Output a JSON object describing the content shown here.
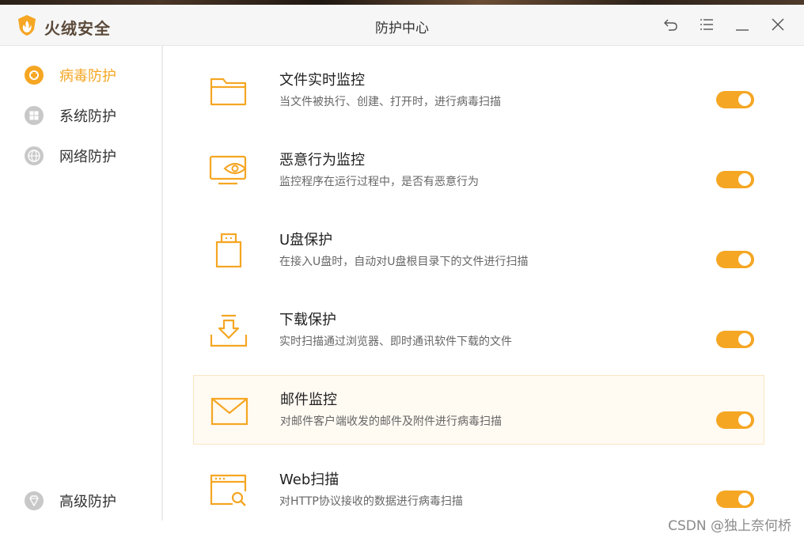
{
  "app": {
    "brand": "火绒安全",
    "window_title": "防护中心"
  },
  "titlebar_icons": [
    "undo-icon",
    "menu-icon",
    "minimize-icon",
    "close-icon"
  ],
  "sidebar": {
    "items": [
      {
        "label": "病毒防护",
        "icon": "virus-shield-icon",
        "active": true
      },
      {
        "label": "系统防护",
        "icon": "windows-icon",
        "active": false
      },
      {
        "label": "网络防护",
        "icon": "globe-icon",
        "active": false
      }
    ],
    "bottom_item": {
      "label": "高级防护",
      "icon": "diamond-icon",
      "active": false
    }
  },
  "features": [
    {
      "title": "文件实时监控",
      "desc": "当文件被执行、创建、打开时，进行病毒扫描",
      "icon": "folder-icon",
      "enabled": true
    },
    {
      "title": "恶意行为监控",
      "desc": "监控程序在运行过程中，是否有恶意行为",
      "icon": "monitor-eye-icon",
      "enabled": true
    },
    {
      "title": "U盘保护",
      "desc": "在接入U盘时，自动对U盘根目录下的文件进行扫描",
      "icon": "usb-drive-icon",
      "enabled": true
    },
    {
      "title": "下载保护",
      "desc": "实时扫描通过浏览器、即时通讯软件下载的文件",
      "icon": "download-icon",
      "enabled": true
    },
    {
      "title": "邮件监控",
      "desc": "对邮件客户端收发的邮件及附件进行病毒扫描",
      "icon": "mail-icon",
      "enabled": true
    },
    {
      "title": "Web扫描",
      "desc": "对HTTP协议接收的数据进行病毒扫描",
      "icon": "web-scan-icon",
      "enabled": true
    }
  ],
  "watermark": "CSDN @独上奈何桥",
  "colors": {
    "accent": "#f5a623",
    "active_text": "#f5a623",
    "icon_gray": "#c8c8c8"
  }
}
